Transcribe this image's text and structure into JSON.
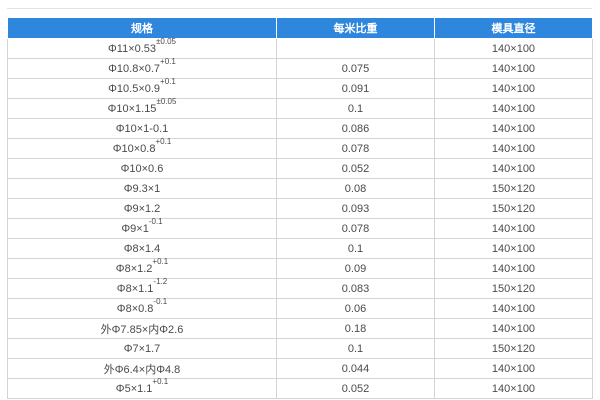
{
  "table": {
    "headers": [
      "规格",
      "每米比重",
      "模具直径"
    ],
    "rows": [
      {
        "spec": "Φ11×0.53",
        "tol": "±0.05",
        "weight": "",
        "die": "140×100"
      },
      {
        "spec": "Φ10.8×0.7",
        "tol": "+0.1",
        "weight": "0.075",
        "die": "140×100"
      },
      {
        "spec": "Φ10.5×0.9",
        "tol": "+0.1",
        "weight": "0.091",
        "die": "140×100"
      },
      {
        "spec": "Φ10×1.15",
        "tol": "±0.05",
        "weight": "0.1",
        "die": "140×100"
      },
      {
        "spec": "Φ10×1-0.1",
        "tol": "",
        "weight": "0.086",
        "die": "140×100"
      },
      {
        "spec": "Φ10×0.8",
        "tol": "+0.1",
        "weight": "0.078",
        "die": "140×100"
      },
      {
        "spec": "Φ10×0.6",
        "tol": "",
        "weight": "0.052",
        "die": "140×100"
      },
      {
        "spec": "Φ9.3×1",
        "tol": "",
        "weight": "0.08",
        "die": "150×120"
      },
      {
        "spec": "Φ9×1.2",
        "tol": "",
        "weight": "0.093",
        "die": "150×120"
      },
      {
        "spec": "Φ9×1",
        "tol": "-0.1",
        "weight": "0.078",
        "die": "140×100"
      },
      {
        "spec": "Φ8×1.4",
        "tol": "",
        "weight": "0.1",
        "die": "140×100"
      },
      {
        "spec": "Φ8×1.2",
        "tol": "+0.1",
        "weight": "0.09",
        "die": "140×100"
      },
      {
        "spec": "Φ8×1.1",
        "tol": "-1.2",
        "weight": "0.083",
        "die": "150×120"
      },
      {
        "spec": "Φ8×0.8",
        "tol": "-0.1",
        "weight": "0.06",
        "die": "140×100"
      },
      {
        "spec": "外Φ7.85×内Φ2.6",
        "tol": "",
        "weight": "0.18",
        "die": "140×100"
      },
      {
        "spec": "Φ7×1.7",
        "tol": "",
        "weight": "0.1",
        "die": "150×120"
      },
      {
        "spec": "外Φ6.4×内Φ4.8",
        "tol": "",
        "weight": "0.044",
        "die": "140×100"
      },
      {
        "spec": "Φ5×1.1",
        "tol": "+0.1",
        "weight": "0.052",
        "die": "140×100"
      }
    ]
  }
}
